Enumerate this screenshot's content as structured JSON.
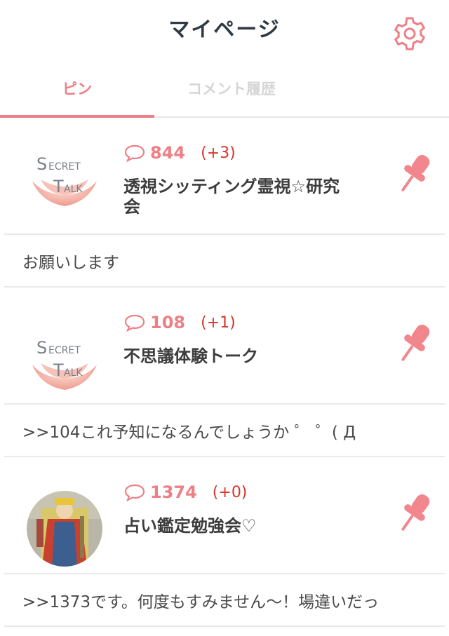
{
  "header": {
    "title": "マイページ",
    "settings_icon": "gear-icon"
  },
  "tabs": [
    {
      "label": "ピン",
      "active": true
    },
    {
      "label": "コメント履歴",
      "active": false
    }
  ],
  "colors": {
    "accent": "#ef7f86",
    "delta": "#d9342b"
  },
  "threads": [
    {
      "logo_line1": "ECRET",
      "logo_line2": "ALK",
      "logo_s": "S",
      "logo_t": "T",
      "count": "844",
      "delta": "(+3)",
      "name": "透視シッティング霊視☆研究会",
      "comment": "お願いします"
    },
    {
      "logo_line1": "ECRET",
      "logo_line2": "ALK",
      "logo_s": "S",
      "logo_t": "T",
      "count": "108",
      "delta": "(+1)",
      "name": "不思議体験トーク",
      "comment": ">>104これ予知になるんでしょうか ゜ ゜( Д"
    },
    {
      "count": "1374",
      "delta": "(+0)",
      "name": "占い鑑定勉強会♡",
      "comment": ">>1373です。何度もすみません〜！場違いだっ"
    }
  ]
}
